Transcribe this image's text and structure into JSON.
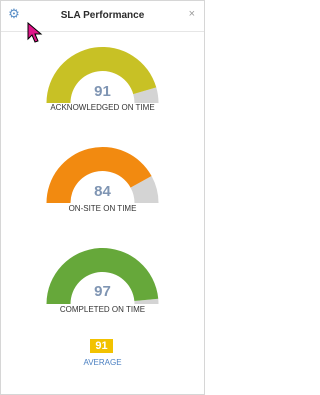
{
  "widget": {
    "title": "SLA Performance",
    "settings_icon": "gear-icon",
    "close_symbol": "×"
  },
  "gauges": [
    {
      "value": "91",
      "percent": 91,
      "label": "ACKNOWLEDGED ON TIME",
      "color": "#c8c125",
      "track": "#d4d4d4"
    },
    {
      "value": "84",
      "percent": 84,
      "label": "ON-SITE ON TIME",
      "color": "#f28a10",
      "track": "#d4d4d4"
    },
    {
      "value": "97",
      "percent": 97,
      "label": "COMPLETED ON TIME",
      "color": "#66a83a",
      "track": "#d4d4d4"
    }
  ],
  "average": {
    "value": "91",
    "label": "AVERAGE",
    "badge_color": "#f2c200"
  }
}
